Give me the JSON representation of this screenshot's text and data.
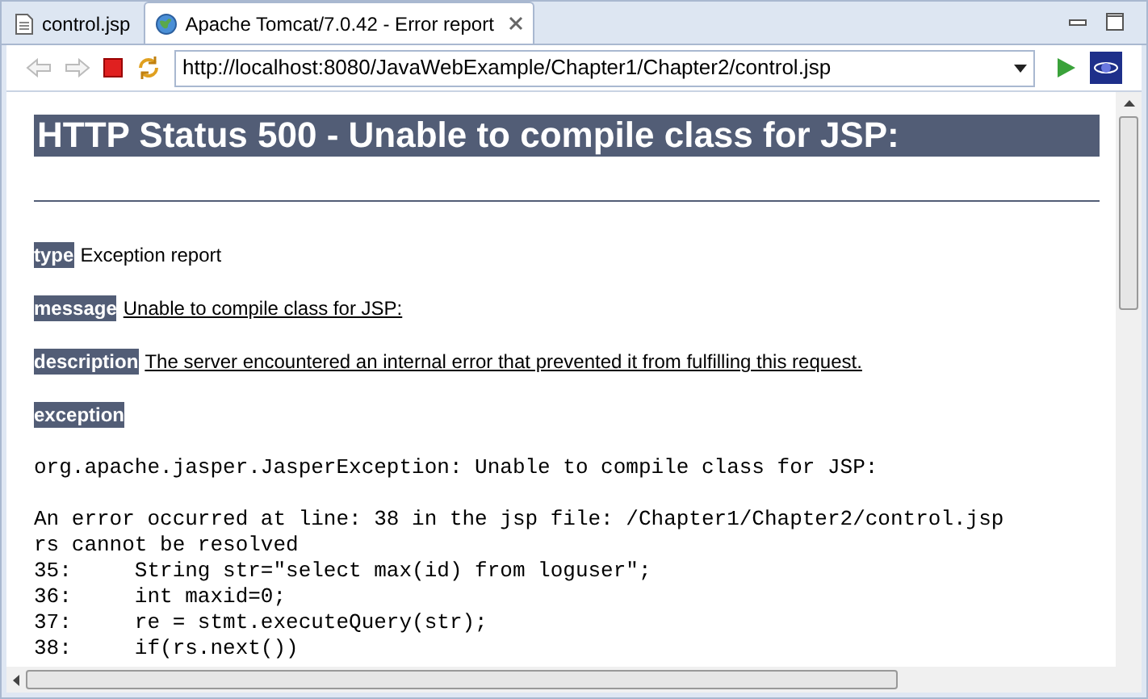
{
  "tabs": [
    {
      "label": "control.jsp",
      "kind": "file",
      "selected": false
    },
    {
      "label": "Apache Tomcat/7.0.42 - Error report",
      "kind": "web",
      "selected": true
    }
  ],
  "toolbar": {
    "url": "http://localhost:8080/JavaWebExample/Chapter1/Chapter2/control.jsp"
  },
  "page": {
    "title": "HTTP Status 500 - Unable to compile class for JSP:",
    "fields": [
      {
        "label": "type",
        "value": "Exception report",
        "underlined": false
      },
      {
        "label": "message",
        "value": "Unable to compile class for JSP:",
        "underlined": true
      },
      {
        "label": "description",
        "value": "The server encountered an internal error that prevented it from fulfilling this request.",
        "underlined": true
      },
      {
        "label": "exception"
      }
    ],
    "code_blocks": [
      [
        "org.apache.jasper.JasperException: Unable to compile class for JSP:"
      ],
      [
        "An error occurred at line: 38 in the jsp file: /Chapter1/Chapter2/control.jsp",
        "rs cannot be resolved",
        "35:     String str=\"select max(id) from loguser\";",
        "36:     int maxid=0;",
        "37:     re = stmt.executeQuery(str);",
        "38:     if(rs.next())"
      ]
    ]
  }
}
